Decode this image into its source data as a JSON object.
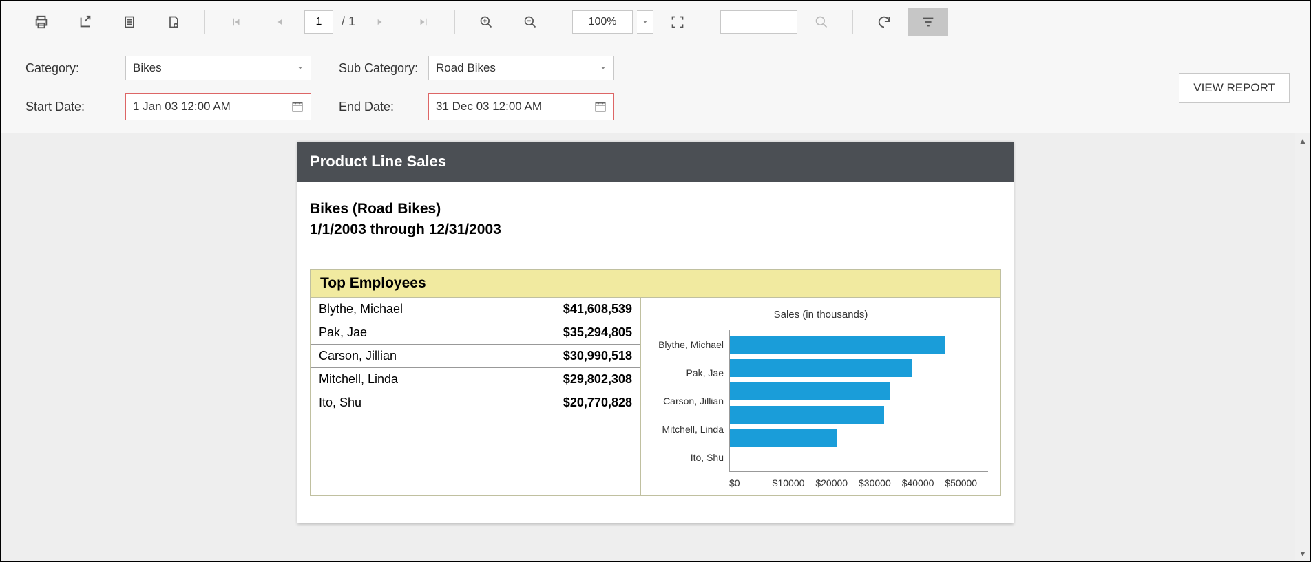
{
  "toolbar": {
    "current_page": "1",
    "total_pages": "/ 1",
    "zoom": "100%"
  },
  "params": {
    "category_label": "Category:",
    "category_value": "Bikes",
    "subcategory_label": "Sub Category:",
    "subcategory_value": "Road Bikes",
    "start_date_label": "Start Date:",
    "start_date_value": "1 Jan 03 12:00 AM",
    "end_date_label": "End Date:",
    "end_date_value": "31 Dec 03 12:00 AM",
    "view_report": "VIEW REPORT"
  },
  "report": {
    "title": "Product Line Sales",
    "subheader": "Bikes (Road Bikes)",
    "date_range": "1/1/2003 through 12/31/2003",
    "section_title": "Top Employees",
    "employees": [
      {
        "name": "Blythe, Michael",
        "value": "$41,608,539"
      },
      {
        "name": "Pak, Jae",
        "value": "$35,294,805"
      },
      {
        "name": "Carson, Jillian",
        "value": "$30,990,518"
      },
      {
        "name": "Mitchell, Linda",
        "value": "$29,802,308"
      },
      {
        "name": "Ito, Shu",
        "value": "$20,770,828"
      }
    ],
    "chart_title": "Sales (in thousands)",
    "x_ticks": [
      "$0",
      "$10000",
      "$20000",
      "$30000",
      "$40000",
      "$50000"
    ]
  },
  "chart_data": {
    "type": "bar",
    "orientation": "horizontal",
    "title": "Sales (in thousands)",
    "xlabel": "",
    "ylabel": "",
    "xlim": [
      0,
      50000
    ],
    "categories": [
      "Blythe, Michael",
      "Pak, Jae",
      "Carson, Jillian",
      "Mitchell, Linda",
      "Ito, Shu"
    ],
    "values": [
      41609,
      35295,
      30991,
      29802,
      20771
    ],
    "x_ticks": [
      0,
      10000,
      20000,
      30000,
      40000,
      50000
    ]
  }
}
